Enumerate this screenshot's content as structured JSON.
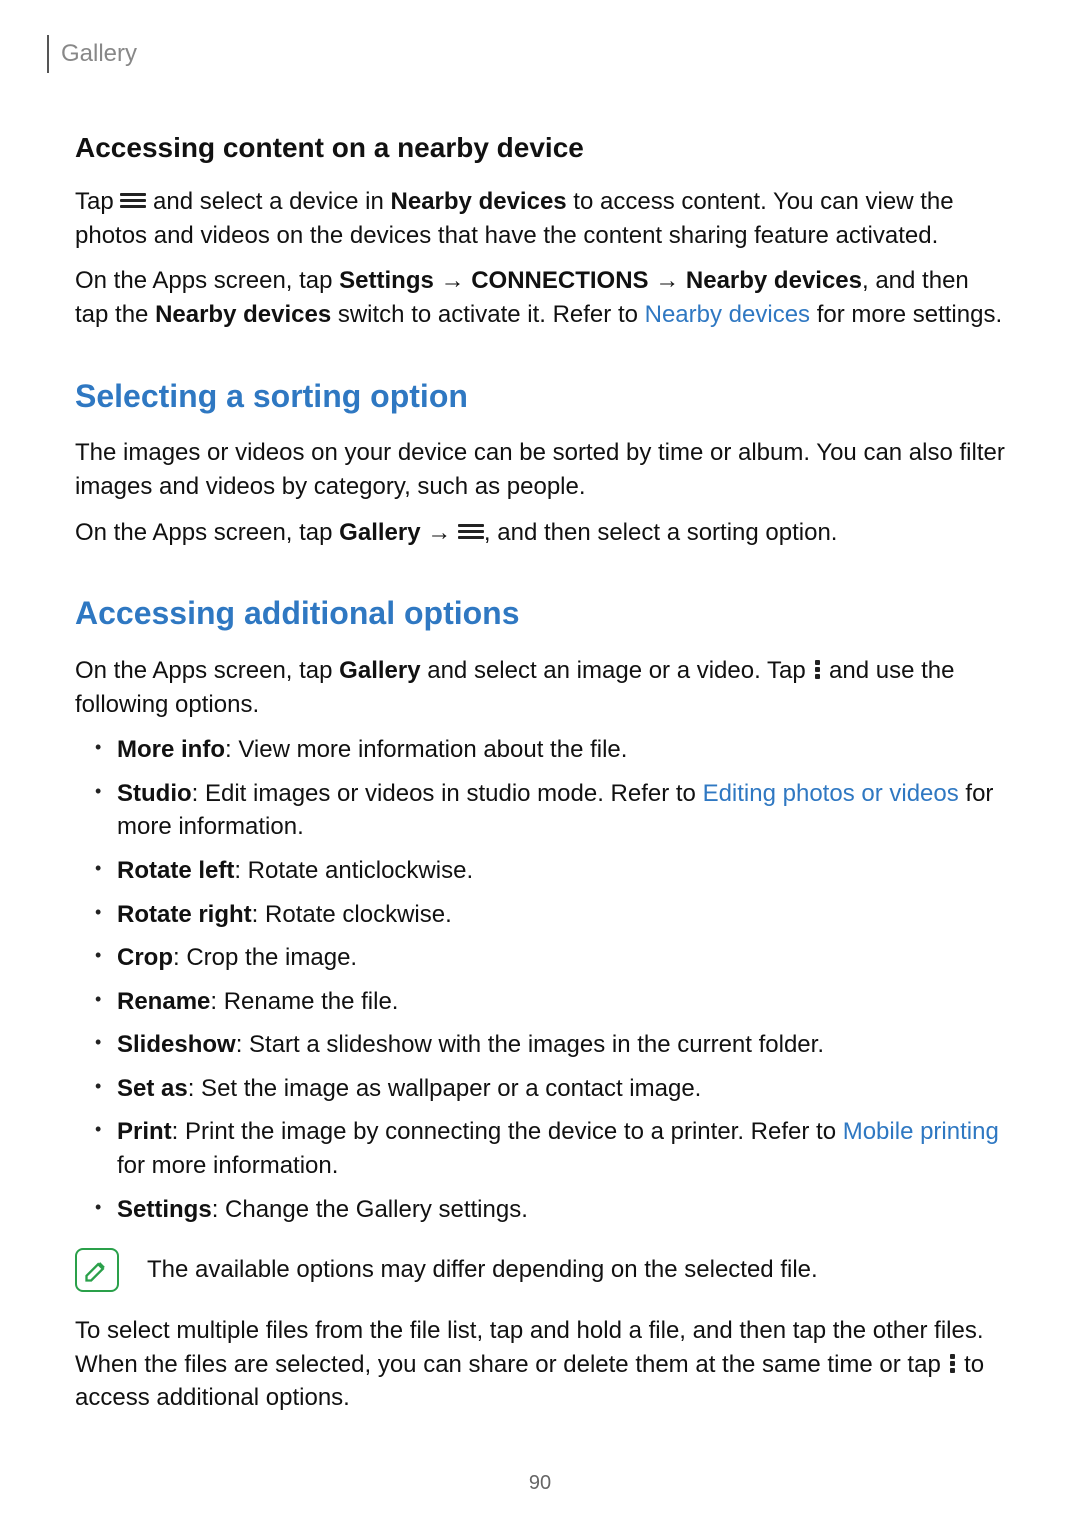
{
  "header": {
    "tab": "Gallery"
  },
  "s1": {
    "title": "Accessing content on a nearby device",
    "p1a": "Tap ",
    "p1b": " and select a device in ",
    "p1c": "Nearby devices",
    "p1d": " to access content. You can view the photos and videos on the devices that have the content sharing feature activated.",
    "p2a": "On the Apps screen, tap ",
    "p2b": "Settings",
    "p2c": " → ",
    "p2d": "CONNECTIONS",
    "p2e": " → ",
    "p2f": "Nearby devices",
    "p2g": ", and then tap the ",
    "p2h": "Nearby devices",
    "p2i": " switch to activate it. Refer to ",
    "p2link": "Nearby devices",
    "p2j": " for more settings."
  },
  "s2": {
    "title": "Selecting a sorting option",
    "p1": "The images or videos on your device can be sorted by time or album. You can also filter images and videos by category, such as people.",
    "p2a": "On the Apps screen, tap ",
    "p2b": "Gallery",
    "p2c": " → ",
    "p2d": ", and then select a sorting option."
  },
  "s3": {
    "title": "Accessing additional options",
    "p1a": "On the Apps screen, tap ",
    "p1b": "Gallery",
    "p1c": " and select an image or a video. Tap ",
    "p1d": " and use the following options.",
    "items": [
      {
        "name": "More info",
        "desc": ": View more information about the file."
      },
      {
        "name": "Studio",
        "desc_a": ": Edit images or videos in studio mode. Refer to ",
        "link": "Editing photos or videos",
        "desc_b": " for more information."
      },
      {
        "name": "Rotate left",
        "desc": ": Rotate anticlockwise."
      },
      {
        "name": "Rotate right",
        "desc": ": Rotate clockwise."
      },
      {
        "name": "Crop",
        "desc": ": Crop the image."
      },
      {
        "name": "Rename",
        "desc": ": Rename the file."
      },
      {
        "name": "Slideshow",
        "desc": ": Start a slideshow with the images in the current folder."
      },
      {
        "name": "Set as",
        "desc": ": Set the image as wallpaper or a contact image."
      },
      {
        "name": "Print",
        "desc_a": ": Print the image by connecting the device to a printer. Refer to ",
        "link": "Mobile printing",
        "desc_b": " for more information."
      },
      {
        "name": "Settings",
        "desc": ": Change the Gallery settings."
      }
    ],
    "note": "The available options may differ depending on the selected file.",
    "p3a": "To select multiple files from the file list, tap and hold a file, and then tap the other files. When the files are selected, you can share or delete them at the same time or tap ",
    "p3b": " to access additional options."
  },
  "pagenum": "90"
}
